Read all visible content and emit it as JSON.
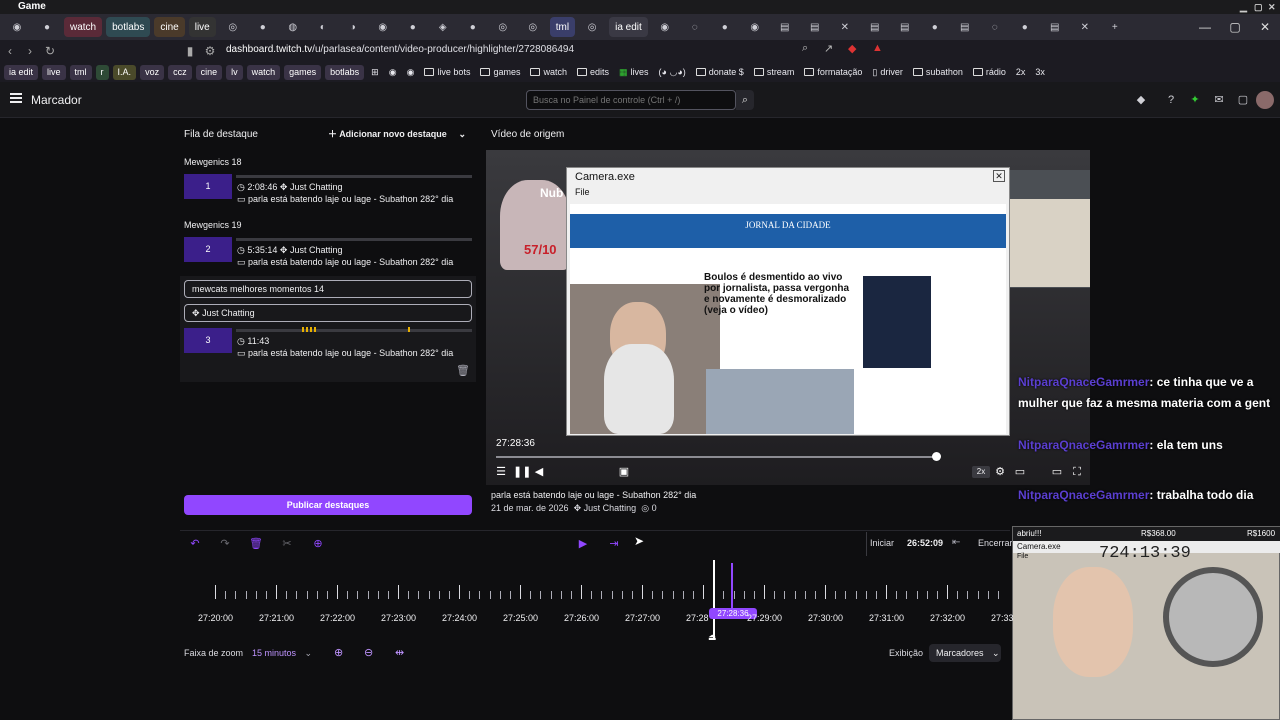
{
  "os": {
    "title": "Game"
  },
  "tabs": [
    {
      "label": "ia edit",
      "kind": "icon"
    },
    {
      "label": "watch",
      "kind": "text"
    },
    {
      "label": "botlabs",
      "kind": "text"
    },
    {
      "label": "cine",
      "kind": "text"
    },
    {
      "label": "live",
      "kind": "text"
    },
    {
      "label": "tml",
      "kind": "text"
    },
    {
      "label": "ia edit",
      "kind": "text"
    }
  ],
  "browser": {
    "url_host": "dashboard.twitch.tv",
    "url_path": "/u/parlasea/content/video-producer/highlighter/2728086494"
  },
  "bookmarks": {
    "buttons": [
      "ia edit",
      "live",
      "tml",
      "r",
      "I.A.",
      "voz",
      "ccz",
      "cine",
      "lv",
      "watch",
      "games",
      "botlabs"
    ],
    "links": [
      "live bots",
      "games",
      "watch",
      "edits",
      "lives",
      "(◕ ◡◕)",
      "donate $",
      "stream",
      "formatação",
      "driver",
      "subathon",
      "rádio",
      "2x",
      "3x"
    ]
  },
  "header": {
    "title": "Marcador",
    "search_placeholder": "Busca no Painel de controle (Ctrl + /)"
  },
  "left": {
    "queue_label": "Fila de destaque",
    "add_label": "Adicionar novo destaque",
    "groups": [
      {
        "name": "Mewgenics 18",
        "num": "1",
        "duration": "2:08:46",
        "category": "Just Chatting",
        "desc": "parla está batendo laje ou lage - Subathon 282° dia"
      },
      {
        "name": "Mewgenics 19",
        "num": "2",
        "duration": "5:35:14",
        "category": "Just Chatting",
        "desc": "parla está batendo laje ou lage - Subathon 282° dia"
      }
    ],
    "editing": {
      "title_value": "mewcats melhores momentos 14",
      "category_value": "Just Chatting",
      "num": "3",
      "duration": "11:43",
      "desc": "parla está batendo laje ou lage - Subathon 282° dia"
    },
    "publish_label": "Publicar destaques"
  },
  "video": {
    "section_label": "Vídeo de origem",
    "cam_window_title": "Camera.exe",
    "cam_menu": "File",
    "site_name": "JORNAL DA CIDADE",
    "headline": "Boulos é desmentido ao vivo por jornalista, passa vergonha e novamente é desmoralizado (veja o vídeo)",
    "sticker_count": "57/10",
    "sticker_text": "Nub",
    "time": "27:28:36",
    "speed": "2x",
    "stream_title": "parla está batendo laje ou lage - Subathon 282° dia",
    "date": "21 de mar. de 2026",
    "category": "Just Chatting",
    "views": "0"
  },
  "chat": {
    "lines": [
      {
        "user": "NitparaQnaceGamrmer",
        "text": ": ce tinha que ve a mulher que faz a mesma materia com a gent"
      },
      {
        "user": "NitparaQnaceGamrmer",
        "text": ": ela tem uns"
      },
      {
        "user": "NitparaQnaceGamrmer",
        "text": ": trabalha todo dia"
      }
    ]
  },
  "timeline": {
    "start_label": "Iniciar",
    "clock": "26:52:09",
    "end_label": "Encerrar",
    "ticks": [
      "27:20:00",
      "27:21:00",
      "27:22:00",
      "27:23:00",
      "27:24:00",
      "27:25:00",
      "27:26:00",
      "27:27:00",
      "27:28",
      "27:29:00",
      "27:30:00",
      "27:31:00",
      "27:32:00",
      "27:33"
    ],
    "playhead": "27:28:36",
    "zoom_label": "Faixa de zoom",
    "zoom_value": "15 minutos",
    "view_label": "Exibição",
    "view_value": "Marcadores"
  },
  "webcam": {
    "top_left": "abriu!!!",
    "top_mid": "R$368.00",
    "top_right": "R$1600",
    "window_title": "Camera.exe",
    "menu": "File",
    "time": "724:13:39"
  },
  "colors": {
    "accent": "#9147ff",
    "bg": "#0e0e10",
    "panel": "#18181b"
  }
}
